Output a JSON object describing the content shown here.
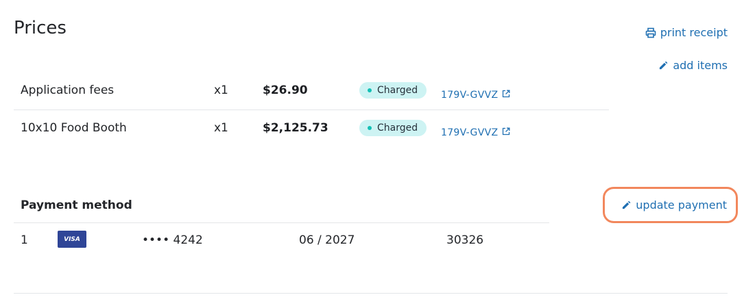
{
  "header": {
    "title": "Prices",
    "print_receipt": "print receipt",
    "add_items": "add items"
  },
  "items": [
    {
      "name": "Application fees",
      "qty": "x1",
      "price": "$26.90",
      "status": "Charged",
      "ref": "179V-GVVZ"
    },
    {
      "name": "10x10 Food Booth",
      "qty": "x1",
      "price": "$2,125.73",
      "status": "Charged",
      "ref": "179V-GVVZ"
    }
  ],
  "payment": {
    "heading": "Payment method",
    "update_label": "update payment",
    "methods": [
      {
        "index": "1",
        "brand": "VISA",
        "card": "•••• 4242",
        "expiry": "06 / 2027",
        "zip": "30326"
      }
    ]
  },
  "colors": {
    "link": "#1f6fb2",
    "badge_bg": "#cdf3f3",
    "badge_dot": "#13c0b5",
    "highlight": "#f2875c",
    "visa": "#2f4597"
  },
  "icons": {
    "print": "printer-icon",
    "edit": "pencil-icon",
    "external": "external-link-icon"
  }
}
